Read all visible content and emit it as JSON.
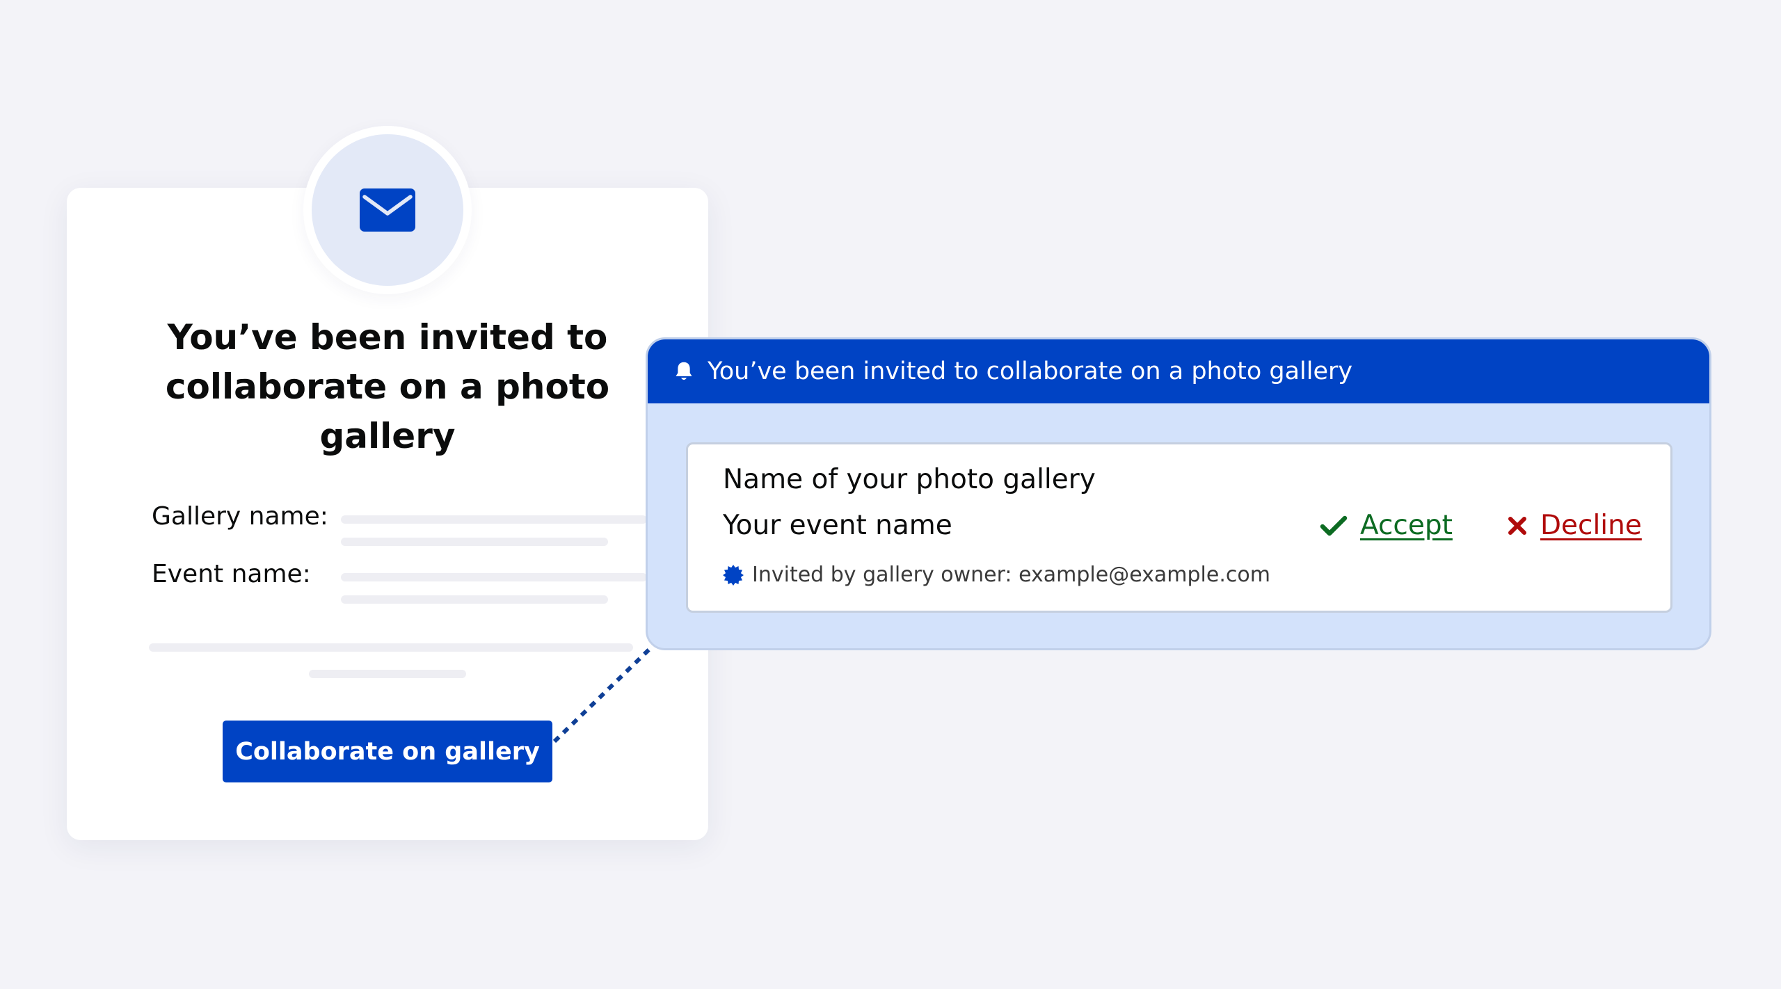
{
  "email": {
    "icon": "envelope-icon",
    "title": "You’ve been invited to collaborate on a photo gallery",
    "gallery_label": "Gallery name:",
    "event_label": "Event name:",
    "button_label": "Collaborate on gallery"
  },
  "notification": {
    "icon": "bell-icon",
    "header": "You’ve been invited to collaborate on a photo gallery",
    "gallery_name": "Name of your photo gallery",
    "event_name": "Your event name",
    "invited_by": "Invited by gallery owner: example@example.com",
    "accept_label": "Accept",
    "decline_label": "Decline"
  },
  "colors": {
    "brand_blue": "#0043c4",
    "panel_bg": "#d3e2fb",
    "accept_green": "#0c6b22",
    "decline_red": "#b00b0b",
    "page_bg": "#f3f3f8"
  }
}
